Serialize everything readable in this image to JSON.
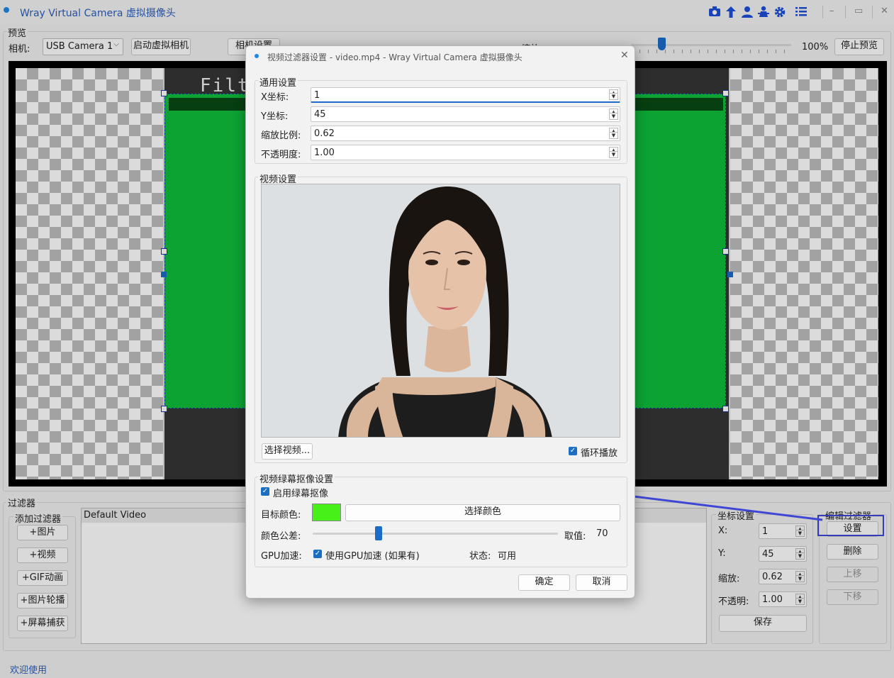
{
  "main_window": {
    "title": "Wray Virtual Camera 虚拟摄像头",
    "toolbar_icons": [
      "camera-icon",
      "upload-icon",
      "user-icon",
      "person-icon",
      "gear-icon",
      "list-icon"
    ],
    "window_controls": [
      "–",
      "▭",
      "✕"
    ],
    "preview_section_title": "预览",
    "camera_label": "相机:",
    "camera_selected": "USB Camera 1",
    "start_virtual_camera_label": "启动虚拟相机",
    "camera_settings_label": "相机设置",
    "zoom_label": "缩放",
    "zoom_value": "100%",
    "zoom_level": 0.19,
    "stop_preview_label": "停止预览",
    "preview_overlay_text": "Filte",
    "filters_section_title": "过滤器",
    "add_filter_title": "添加过滤器",
    "add_filter_buttons": [
      "+图片",
      "+视频",
      "+GIF动画",
      "+图片轮播",
      "+屏幕捕获"
    ],
    "filter_list": [
      "Default Video"
    ],
    "coord_title": "坐标设置",
    "coord_x_label": "X:",
    "coord_x_value": "1",
    "coord_y_label": "Y:",
    "coord_y_value": "45",
    "coord_scale_label": "缩放:",
    "coord_scale_value": "0.62",
    "coord_opacity_label": "不透明:",
    "coord_opacity_value": "1.00",
    "save_label": "保存",
    "edit_filter_title": "编辑过滤器",
    "settings_label": "设置",
    "delete_label": "删除",
    "move_up_label": "上移",
    "move_down_label": "下移",
    "status_text": "欢迎使用"
  },
  "dialog": {
    "title": "视频过滤器设置 - video.mp4 - Wray Virtual Camera 虚拟摄像头",
    "close_glyph": "✕",
    "general_title": "通用设置",
    "x_label": "X坐标:",
    "x_value": "1",
    "y_label": "Y坐标:",
    "y_value": "45",
    "scale_label": "缩放比例:",
    "scale_value": "0.62",
    "opacity_label": "不透明度:",
    "opacity_value": "1.00",
    "video_title": "视频设置",
    "select_video_label": "选择视频...",
    "loop_label": "循环播放",
    "loop_checked": true,
    "greenscreen_title": "视频绿幕抠像设置",
    "enable_greenscreen_label": "启用绿幕抠像",
    "enable_greenscreen_checked": true,
    "target_color_label": "目标颜色:",
    "target_color": "#48f01a",
    "choose_color_label": "选择颜色",
    "tolerance_label": "颜色公差:",
    "tolerance_value_label": "取值:",
    "tolerance_value": "70",
    "tolerance_level": 0.27,
    "gpu_label": "GPU加速:",
    "gpu_checkbox_label": "使用GPU加速 (如果有)",
    "gpu_checked": true,
    "status_label": "状态:",
    "status_value": "可用",
    "ok_label": "确定",
    "cancel_label": "取消"
  },
  "colors": {
    "accent": "#1d4ed8",
    "green_screen": "#0fbe3c",
    "annotation": "#3e47d4"
  }
}
